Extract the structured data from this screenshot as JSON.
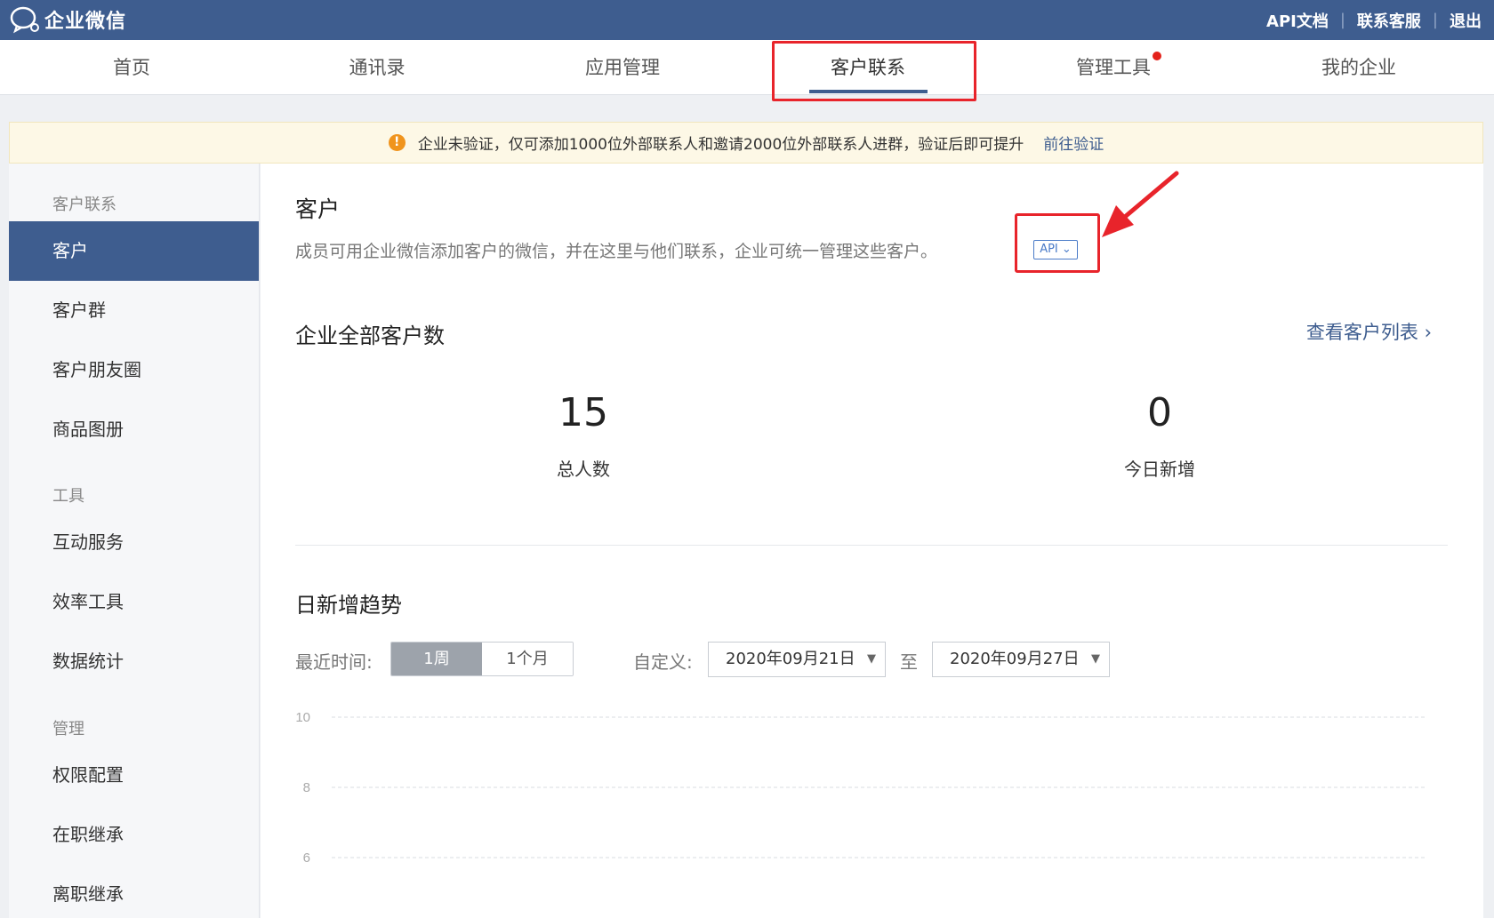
{
  "app": {
    "logo_text": "企业微信",
    "links": [
      "API文档",
      "联系客服",
      "退出"
    ]
  },
  "nav": {
    "items": [
      "首页",
      "通讯录",
      "应用管理",
      "客户联系",
      "管理工具",
      "我的企业"
    ],
    "active": "客户联系"
  },
  "notice": {
    "icon": "!",
    "text": "企业未验证，仅可添加1000位外部联系人和邀请2000位外部联系人进群，验证后即可提升",
    "link": "前往验证"
  },
  "sidebar": {
    "group1": "客户联系",
    "items1": [
      "客户",
      "客户群",
      "客户朋友圈",
      "商品图册"
    ],
    "group2": "工具",
    "items2": [
      "互动服务",
      "效率工具",
      "数据统计"
    ],
    "group3": "管理",
    "items3": [
      "权限配置",
      "在职继承",
      "离职继承"
    ]
  },
  "main": {
    "title": "客户",
    "desc": "成员可用企业微信添加客户的微信，并在这里与他们联系，企业可统一管理这些客户。",
    "api_badge": "API ⌄",
    "total_title": "企业全部客户数",
    "view_list": "查看客户列表 ›",
    "stats": [
      {
        "value": "15",
        "label": "总人数"
      },
      {
        "value": "0",
        "label": "今日新增"
      }
    ],
    "trend_title": "日新增趋势",
    "range_label": "最近时间:",
    "range_options": [
      "1周",
      "1个月"
    ],
    "custom_label": "自定义:",
    "date_from": "2020年09月21日",
    "to_label": "至",
    "date_to": "2020年09月27日"
  },
  "chart_data": {
    "type": "line",
    "ytick_labels": [
      "10",
      "8",
      "6"
    ],
    "grid": true
  },
  "colors": {
    "brand": "#3e5d8f",
    "highlight": "#e8242b",
    "warning": "#f0941d"
  }
}
